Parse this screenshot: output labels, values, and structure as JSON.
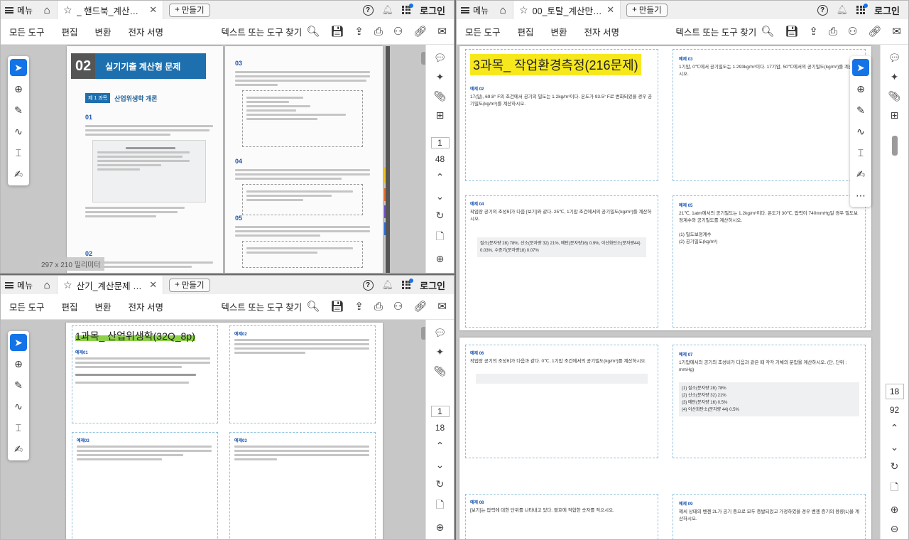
{
  "common": {
    "menu": "메뉴",
    "new_tab": "만들기",
    "login": "로그인",
    "cmd": [
      "모든 도구",
      "편집",
      "변환",
      "전자 서명"
    ],
    "find": "텍스트 또는 도구 찾기"
  },
  "win1": {
    "tab_title": "_ 핸드북_계산문제.pdf",
    "page": "1",
    "total": "48",
    "page_size": "297 x 210 밀리미터",
    "chapter_num": "02",
    "chapter_title": "실기기출 계산형 문제",
    "section": "제 1 과목",
    "section_title": "산업위생학 개론",
    "q_nums": [
      "01",
      "02",
      "03",
      "04",
      "05"
    ]
  },
  "win2": {
    "tab_title": "산기_계산문제 틀린...",
    "page": "1",
    "total": "18",
    "heading": "1과목_ 산업위생학(32Q_8p)"
  },
  "win3": {
    "tab_title": "00_토탈_계산만_문제...",
    "page": "18",
    "total": "92",
    "heading": "3과목_ 작업환경측정(216문제)",
    "cards": [
      {
        "label": "예제 02",
        "text": "17(일), 69.8° F의 조건에서 공기의 밀도는 1.2kg/m³이다. 온도가 93.5° F로 변화되었을 경우 공기밀도(kg/m³)를 계산하시오."
      },
      {
        "label": "예제 03",
        "text": "1기압, 0℃에서 공기밀도는 1.293kg/m³이다. 17기압, 50℃에서의 공기밀도(kg/m³)를 계산하시오."
      },
      {
        "label": "예제 04",
        "text": "작업장 공기의 조성비가 다음 [보기]와 같다. 25℃, 1기압 조건에서의 공기밀도(kg/m³)를 계산하시오."
      },
      {
        "label": "예제 05",
        "text": "21℃, 1atm에서의 공기밀도는 1.2kg/m³이다. 온도가 30℃, 압력이 740mmHg일 경우 밀도보정계수와 공기밀도를 계산하시오."
      },
      {
        "label": "예제 06",
        "text": "작업장 공기의 조성비가 다음과 같다. 0℃, 1기압 조건에서의 공기밀도(kg/m³)를 계산하시오."
      },
      {
        "label": "예제 07",
        "text": "1기압에서의 공기의 조성비가 다음과 같은 때 각각 기체의 분압을 계산하시오. (단, 단위 : mmHg)"
      },
      {
        "label": "예제 08",
        "text": "[보기]는 압력에 대한 단위를 나타내고 있다. 괄호에 적합한 숫자를 적으시오."
      },
      {
        "label": "예제 09",
        "text": "혜씨 상태의 벤젠 2L가 공기 중으로 모두 증발되었고 가정하였을 경우 벤젠 증기의 용량(L)을 계산하시오."
      }
    ],
    "mix_text": "질소(분자량 28) 78%, 산소(분자량 32) 21%, 메탄(분자량16) 0.9%, 이산화탄소(분자량44) 0.03%, 수증기(분자량18) 0.07%",
    "list_07": [
      "(1) 질소(분자량 28) 78%",
      "(2) 산소(분자량 32) 21%",
      "(3) 메탄(분자량 16) 0.5%",
      "(4) 이산화탄소(분자량 44) 0.5%"
    ],
    "list_05": [
      "(1) 밀도보정계수",
      "(2) 공기밀도(kg/m³)"
    ]
  }
}
